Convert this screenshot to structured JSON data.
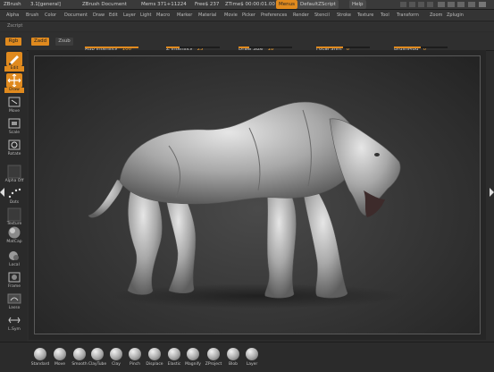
{
  "titlebar": {
    "app": "ZBrush",
    "version": "3.1[general]",
    "document": "ZBrush Document",
    "mem": "Mems 371+11224",
    "free": "Free$ 237",
    "ztime": "ZTime$ 00:00:01.00",
    "menus_btn": "Menus",
    "script_btn": "DefaultZScript",
    "help_btn": "Help",
    "accent": "#e08a1e"
  },
  "menubar": {
    "items": [
      "Alpha",
      "Brush",
      "Color",
      "Document",
      "Draw",
      "Edit",
      "Layer",
      "Light",
      "Macro",
      "Marker",
      "Material",
      "Movie",
      "Picker",
      "Preferences",
      "Render",
      "Stencil",
      "Stroke",
      "Texture",
      "Tool",
      "Transform",
      "Zoom",
      "Zplugin"
    ],
    "extra": "Zscript"
  },
  "shelf": {
    "rgb": "Rgb",
    "zadd": "Zadd",
    "zsub": "Zsub",
    "rgb_intensity": {
      "label": "Rgb Intensity",
      "value": "100",
      "level": 1.0
    },
    "z_intensity": {
      "label": "Z Intensity",
      "value": "25",
      "level": 0.25
    },
    "draw_size": {
      "label": "Draw Size",
      "value": "18",
      "level": 0.2
    },
    "focal_shift": {
      "label": "Focal Shift",
      "value": "0",
      "level": 0.5
    },
    "brush_mod": {
      "label": "BrushMod",
      "value": "0",
      "level": 0.5
    }
  },
  "lefttools": [
    {
      "name": "tool-edit",
      "label": "Edit",
      "icon": "edit-icon",
      "active": true
    },
    {
      "name": "tool-draw",
      "label": "Draw",
      "icon": "draw-icon",
      "active": true
    },
    {
      "name": "tool-move",
      "label": "Move",
      "icon": "move-icon",
      "active": false
    },
    {
      "name": "tool-scale",
      "label": "Scale",
      "icon": "scale-icon",
      "active": false
    },
    {
      "name": "tool-rotate",
      "label": "Rotate",
      "icon": "rotate-icon",
      "active": false
    },
    {
      "name": "tool-alpha",
      "label": "Alpha Off",
      "icon": "alpha-icon",
      "active": false
    },
    {
      "name": "tool-dots",
      "label": "Dots",
      "icon": "dots-icon",
      "active": false
    },
    {
      "name": "tool-texture",
      "label": "Texture",
      "icon": "texture-icon",
      "active": false
    },
    {
      "name": "tool-matcap",
      "label": "MatCap",
      "icon": "matcap-icon",
      "active": false
    },
    {
      "name": "tool-local",
      "label": "Local",
      "icon": "local-icon",
      "active": false
    },
    {
      "name": "tool-frame",
      "label": "Frame",
      "icon": "frame-icon",
      "active": false
    },
    {
      "name": "tool-lasso",
      "label": "Lasso",
      "icon": "lasso-icon",
      "active": false
    },
    {
      "name": "tool-lsym",
      "label": "L.Sym",
      "icon": "lsym-icon",
      "active": false
    }
  ],
  "brushes": [
    "Standard",
    "Move",
    "Smooth",
    "ClayTube",
    "Clay",
    "Pinch",
    "Displace",
    "Elastic",
    "Magnify",
    "ZProject",
    "Blob",
    "Layer"
  ],
  "canvas": {
    "subject": "sculpted-creature-model"
  }
}
